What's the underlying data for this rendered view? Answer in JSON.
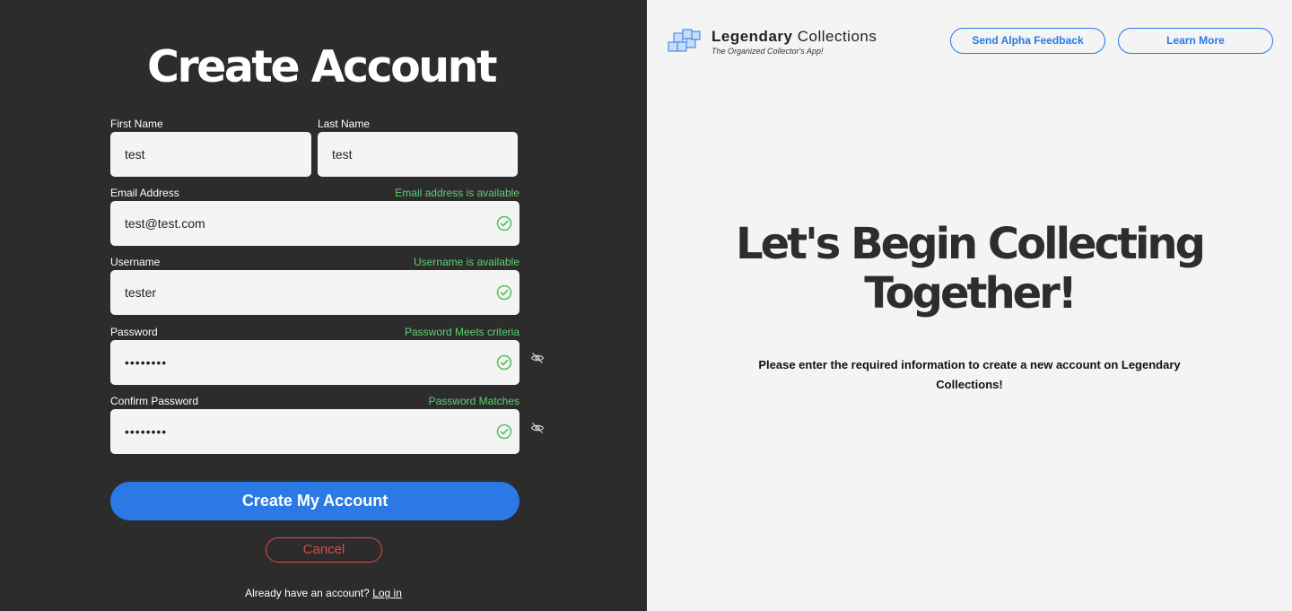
{
  "form": {
    "title": "Create Account",
    "first_name": {
      "label": "First Name",
      "value": "test"
    },
    "last_name": {
      "label": "Last Name",
      "value": "test"
    },
    "email": {
      "label": "Email Address",
      "value": "test@test.com",
      "status": "Email address is available"
    },
    "username": {
      "label": "Username",
      "value": "tester",
      "status": "Username is available"
    },
    "password": {
      "label": "Password",
      "value": "••••••••",
      "status": "Password Meets criteria"
    },
    "confirm_password": {
      "label": "Confirm Password",
      "value": "••••••••",
      "status": "Password Matches"
    },
    "submit_label": "Create My Account",
    "cancel_label": "Cancel",
    "login_prompt": "Already have an account?",
    "login_link": "Log in"
  },
  "header": {
    "brand_bold": "Legendary",
    "brand_light": "Collections",
    "tagline": "The Organized Collector's App!",
    "feedback_label": "Send Alpha Feedback",
    "learn_more_label": "Learn More"
  },
  "hero": {
    "line1": "Let's Begin Collecting",
    "line2": "Together!",
    "subtitle": "Please enter the required information to create a new account on Legendary Collections!"
  },
  "colors": {
    "accent": "#2b79e5",
    "success": "#5fcf72",
    "danger": "#e04848",
    "panel_dark": "#2c2c2c",
    "panel_light": "#f4f4f4"
  },
  "icons": {
    "check": "check-circle-icon",
    "eye": "eye-off-icon",
    "logo": "stacked-boxes-logo-icon"
  }
}
